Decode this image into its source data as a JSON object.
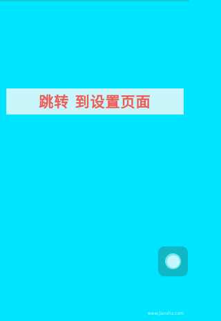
{
  "main": {
    "button_label": "跳转 到设置页面"
  },
  "floating_action": {
    "icon": "circle-icon"
  },
  "footer": {
    "watermark": "www.jianshu.com"
  },
  "colors": {
    "background": "#00e5ff",
    "button_bg": "#c9f6fb",
    "button_text": "#f05a55",
    "floating_button": "#10b7c7"
  }
}
